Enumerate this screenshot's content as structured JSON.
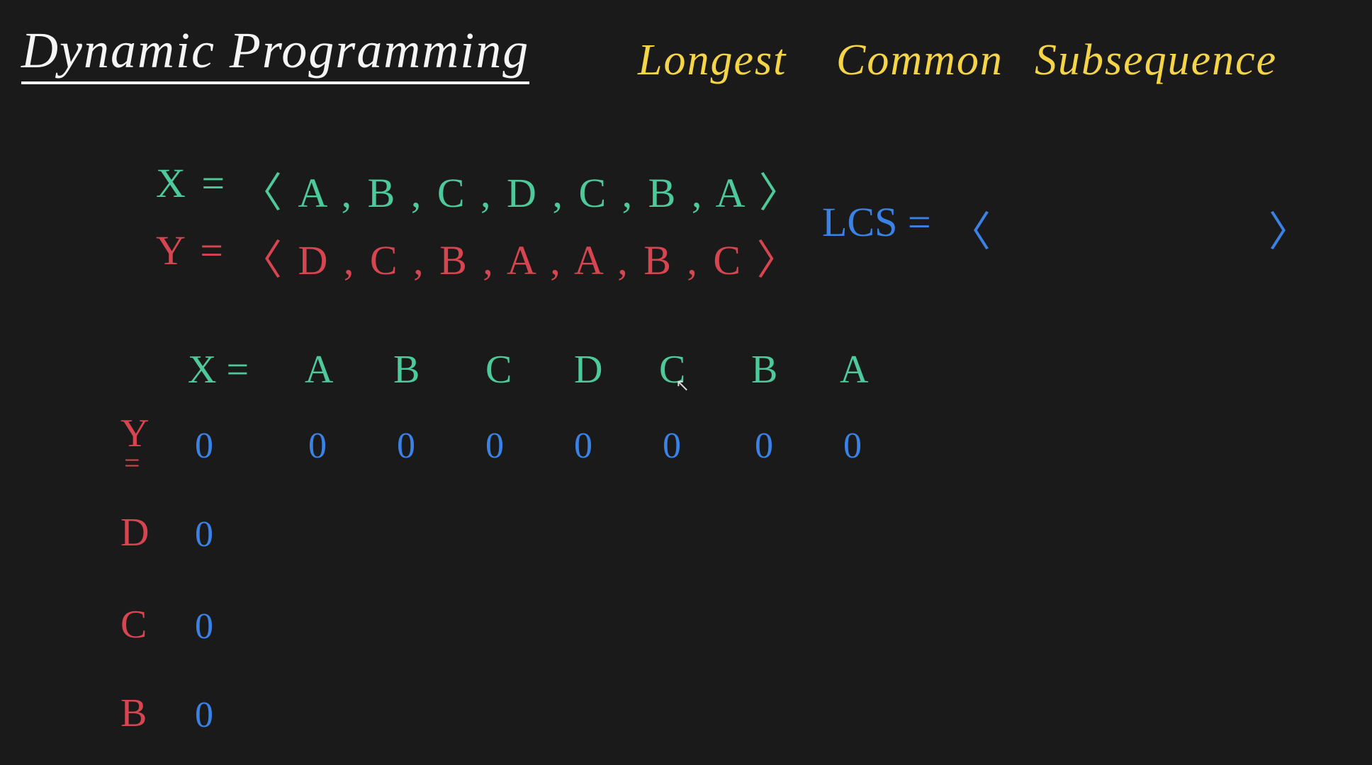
{
  "title": "Dynamic Programming",
  "subtitle": {
    "w1": "Longest",
    "w2": "Common",
    "w3": "Subsequence"
  },
  "sequences": {
    "x_label": "X =",
    "x_value": "〈 A , B , C , D , C , B , A 〉",
    "y_label": "Y =",
    "y_value": "〈 D , C , B , A , A , B , C 〉"
  },
  "lcs": {
    "label": "LCS =",
    "open": "〈",
    "close": "〉"
  },
  "table": {
    "x_eq": "X =",
    "x_headers": [
      "A",
      "B",
      "C",
      "D",
      "C",
      "B",
      "A"
    ],
    "y_eq": "Y",
    "y_eq2": "=",
    "y_headers": [
      "D",
      "C",
      "B"
    ],
    "row0": [
      "0",
      "0",
      "0",
      "0",
      "0",
      "0",
      "0",
      "0"
    ],
    "col0": [
      "0",
      "0",
      "0"
    ]
  }
}
